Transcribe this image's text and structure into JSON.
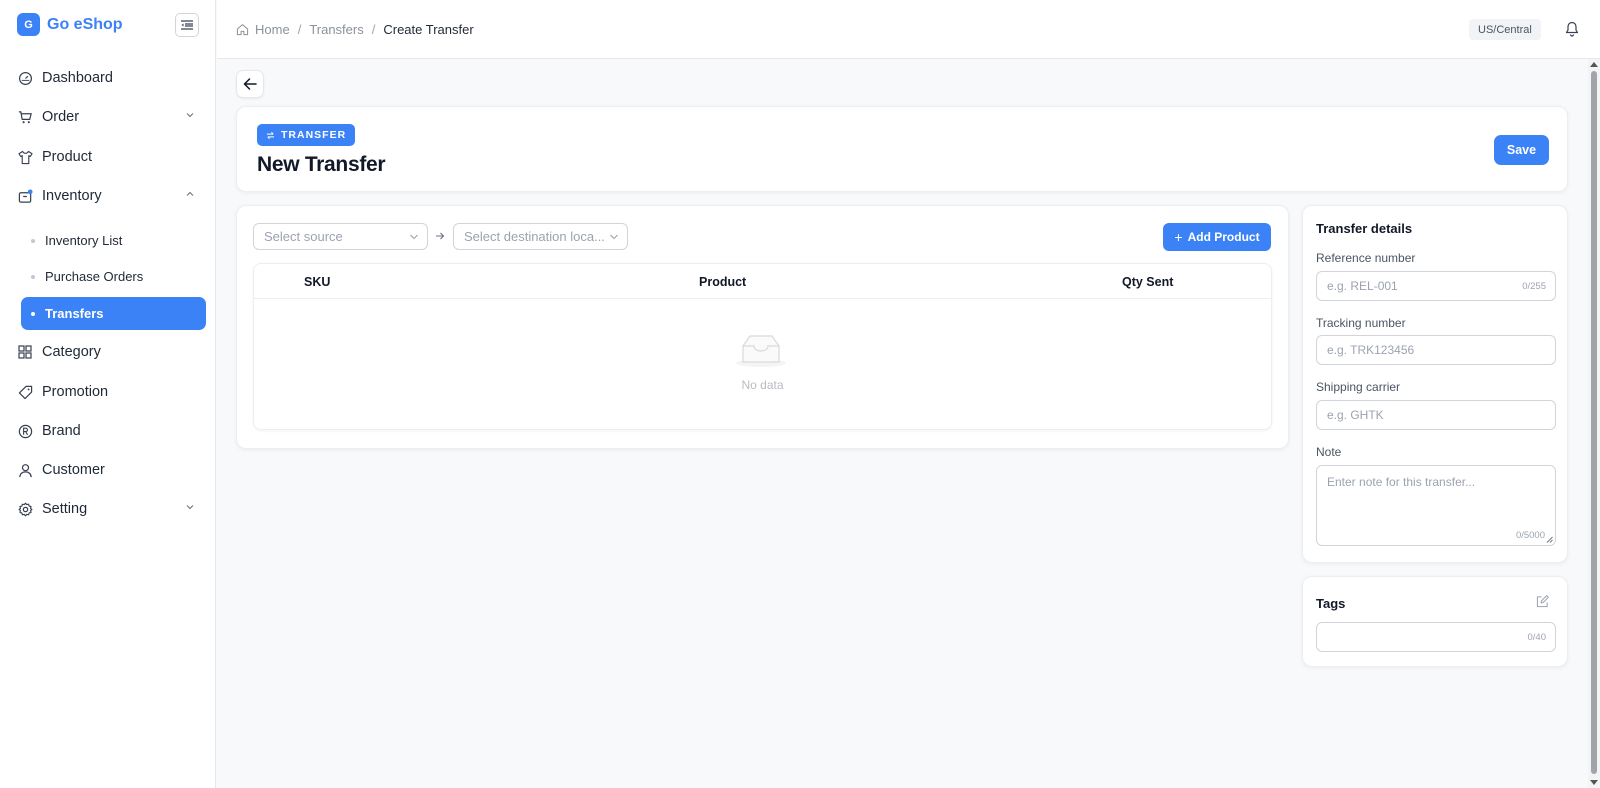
{
  "brand": {
    "logo_letter": "G",
    "name": "Go eShop",
    "color": "#3b82f6"
  },
  "sidebar": {
    "items": [
      {
        "label": "Dashboard",
        "icon": "dashboard-icon"
      },
      {
        "label": "Order",
        "icon": "cart-icon",
        "expandable": true
      },
      {
        "label": "Product",
        "icon": "shirt-icon"
      },
      {
        "label": "Inventory",
        "icon": "inventory-icon",
        "expanded": true
      },
      {
        "label": "Category",
        "icon": "grid-icon"
      },
      {
        "label": "Promotion",
        "icon": "tag-icon"
      },
      {
        "label": "Brand",
        "icon": "registered-icon"
      },
      {
        "label": "Customer",
        "icon": "user-icon"
      },
      {
        "label": "Setting",
        "icon": "gear-icon",
        "expandable": true
      }
    ],
    "inventory_sub": [
      {
        "label": "Inventory List"
      },
      {
        "label": "Purchase Orders"
      },
      {
        "label": "Transfers",
        "active": true
      }
    ]
  },
  "topbar": {
    "breadcrumb": [
      "Home",
      "Transfers",
      "Create Transfer"
    ],
    "breadcrumb_sep": "/",
    "timezone": "US/Central"
  },
  "header": {
    "badge": "TRANSFER",
    "title": "New Transfer",
    "save_label": "Save"
  },
  "transfer": {
    "source_placeholder": "Select source",
    "destination_placeholder": "Select destination loca...",
    "add_product_label": "Add Product",
    "columns": [
      "SKU",
      "Product",
      "Qty Sent"
    ],
    "empty_text": "No data"
  },
  "details": {
    "title": "Transfer details",
    "reference_label": "Reference number",
    "reference_placeholder": "e.g. REL-001",
    "reference_counter": "0/255",
    "tracking_label": "Tracking number",
    "tracking_placeholder": "e.g. TRK123456",
    "carrier_label": "Shipping carrier",
    "carrier_placeholder": "e.g. GHTK",
    "note_label": "Note",
    "note_placeholder": "Enter note for this transfer...",
    "note_counter": "0/5000"
  },
  "tags": {
    "title": "Tags",
    "counter": "0/40"
  }
}
